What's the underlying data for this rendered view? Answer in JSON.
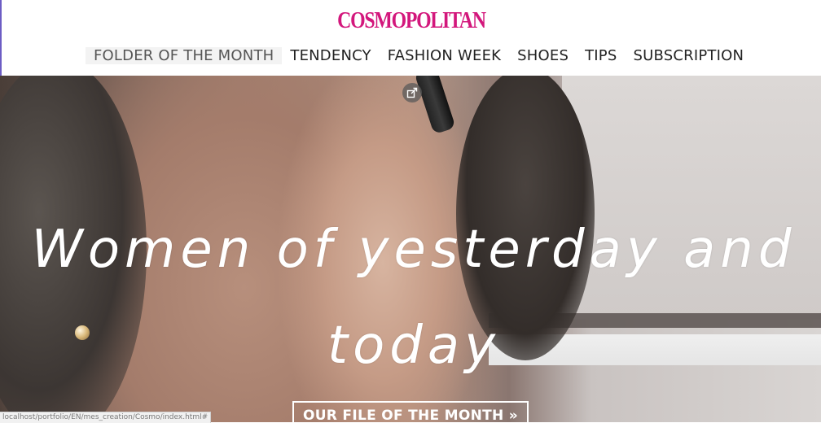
{
  "header": {
    "logo_text": "COSMOPOLITAN",
    "brand_color": "#d3177c"
  },
  "nav": {
    "items": [
      {
        "label": "FOLDER OF THE MONTH",
        "active": true
      },
      {
        "label": "TENDENCY",
        "active": false
      },
      {
        "label": "FASHION WEEK",
        "active": false
      },
      {
        "label": "SHOES",
        "active": false
      },
      {
        "label": "TIPS",
        "active": false
      },
      {
        "label": "SUBSCRIPTION",
        "active": false
      }
    ]
  },
  "hero": {
    "headline": "Women of yesterday and today",
    "cta_label": "OUR FILE OF THE MONTH »",
    "popout_icon": "popout-icon"
  },
  "status_bar": {
    "url": "localhost/portfolio/EN/mes_creation/Cosmo/index.html#"
  }
}
